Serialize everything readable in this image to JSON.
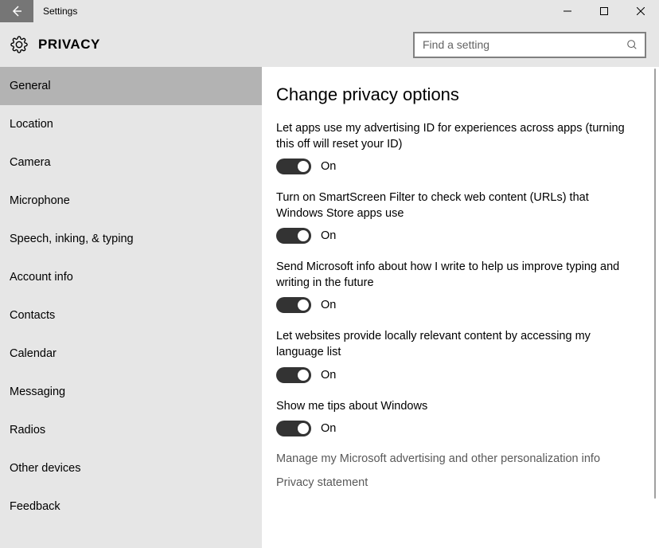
{
  "titlebar": {
    "app_title": "Settings"
  },
  "header": {
    "page_title": "PRIVACY",
    "search_placeholder": "Find a setting"
  },
  "sidebar": {
    "items": [
      {
        "label": "General",
        "selected": true
      },
      {
        "label": "Location",
        "selected": false
      },
      {
        "label": "Camera",
        "selected": false
      },
      {
        "label": "Microphone",
        "selected": false
      },
      {
        "label": "Speech, inking, & typing",
        "selected": false
      },
      {
        "label": "Account info",
        "selected": false
      },
      {
        "label": "Contacts",
        "selected": false
      },
      {
        "label": "Calendar",
        "selected": false
      },
      {
        "label": "Messaging",
        "selected": false
      },
      {
        "label": "Radios",
        "selected": false
      },
      {
        "label": "Other devices",
        "selected": false
      },
      {
        "label": "Feedback",
        "selected": false
      }
    ]
  },
  "main": {
    "heading": "Change privacy options",
    "settings": [
      {
        "desc": "Let apps use my advertising ID for experiences across apps (turning this off will reset your ID)",
        "state_label": "On"
      },
      {
        "desc": "Turn on SmartScreen Filter to check web content (URLs) that Windows Store apps use",
        "state_label": "On"
      },
      {
        "desc": "Send Microsoft info about how I write to help us improve typing and writing in the future",
        "state_label": "On"
      },
      {
        "desc": "Let websites provide locally relevant content by accessing my language list",
        "state_label": "On"
      },
      {
        "desc": "Show me tips about Windows",
        "state_label": "On"
      }
    ],
    "links": [
      "Manage my Microsoft advertising and other personalization info",
      "Privacy statement"
    ]
  }
}
